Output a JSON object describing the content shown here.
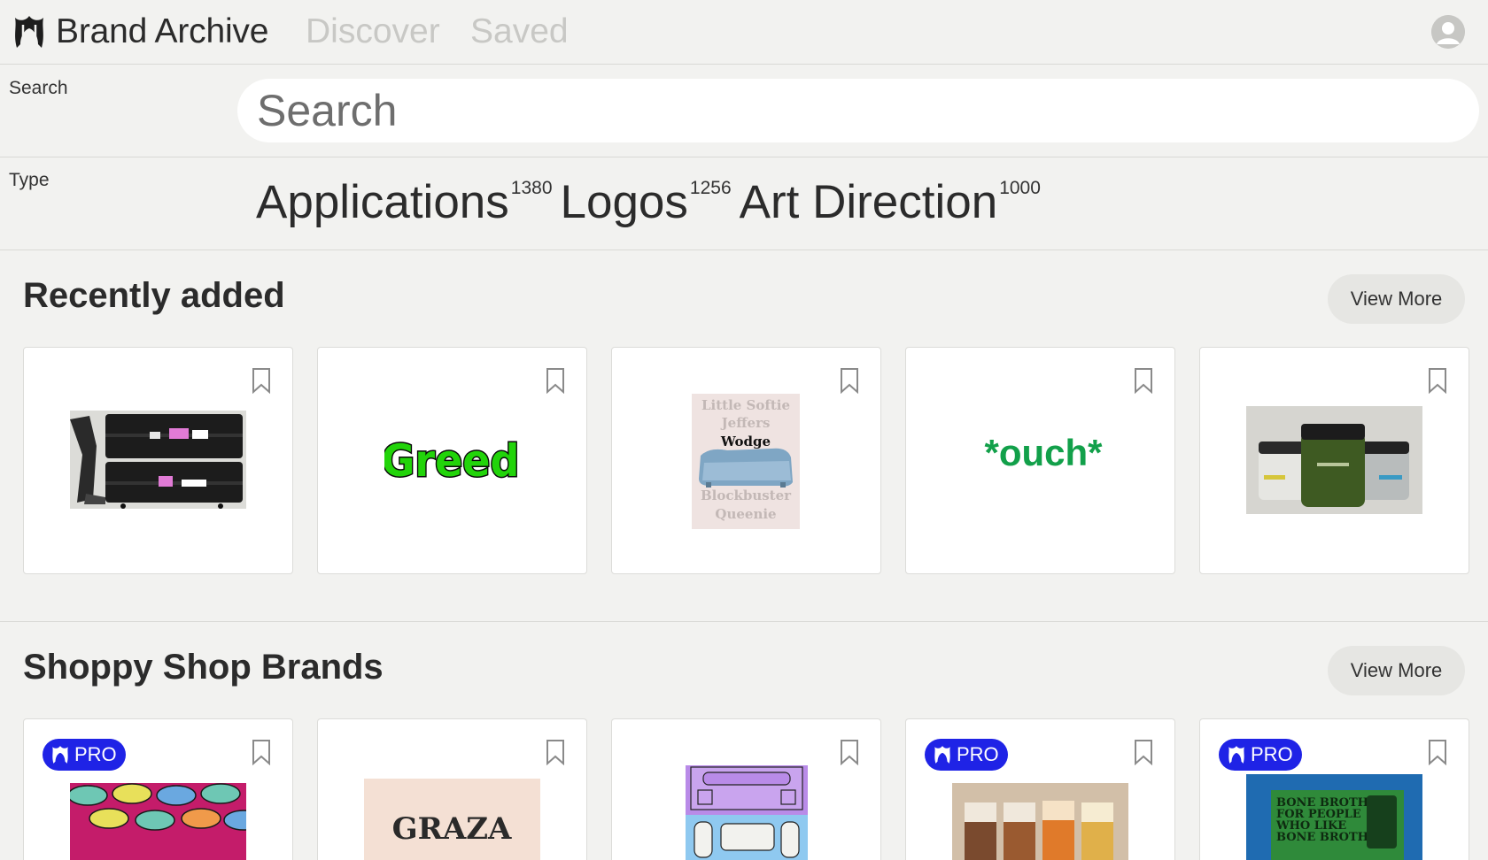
{
  "nav": {
    "brand": "Brand Archive",
    "links": [
      "Discover",
      "Saved"
    ]
  },
  "search": {
    "label": "Search",
    "placeholder": "Search"
  },
  "type_filter": {
    "label": "Type",
    "items": [
      {
        "name": "Applications",
        "count": "1380"
      },
      {
        "name": "Logos",
        "count": "1256"
      },
      {
        "name": "Art Direction",
        "count": "1000"
      }
    ]
  },
  "sections": [
    {
      "title": "Recently added",
      "view_more": "View More",
      "cards": [
        {
          "image": "black-cases-stickers",
          "pro": false
        },
        {
          "image": "greed-wordmark",
          "pro": false,
          "text": "Greed"
        },
        {
          "image": "sofa-poster",
          "pro": false,
          "lines": [
            "Little Softie",
            "Jeffers",
            "Wodge",
            "Blockbuster",
            "Queenie"
          ]
        },
        {
          "image": "ouch-wordmark",
          "pro": false,
          "text": "*ouch*"
        },
        {
          "image": "green-jars",
          "pro": false
        }
      ]
    },
    {
      "title": "Shoppy Shop Brands",
      "view_more": "View More",
      "cards": [
        {
          "image": "pink-tins",
          "pro": true,
          "badge": "PRO"
        },
        {
          "image": "graza-packaging",
          "pro": false,
          "text": "GRAZA"
        },
        {
          "image": "chilly-willy-packaging",
          "pro": false
        },
        {
          "image": "chocolate-bars",
          "pro": true,
          "badge": "PRO"
        },
        {
          "image": "bone-broth-poster",
          "pro": true,
          "badge": "PRO",
          "lines": [
            "BONE BROTH",
            "FOR PEOPLE",
            "WHO LIKE",
            "BONE BROTH"
          ]
        }
      ]
    }
  ],
  "colors": {
    "background": "#f2f2f0",
    "pro_badge": "#1f23e6",
    "greed_green": "#22d40a",
    "ouch_green": "#12a04a"
  }
}
